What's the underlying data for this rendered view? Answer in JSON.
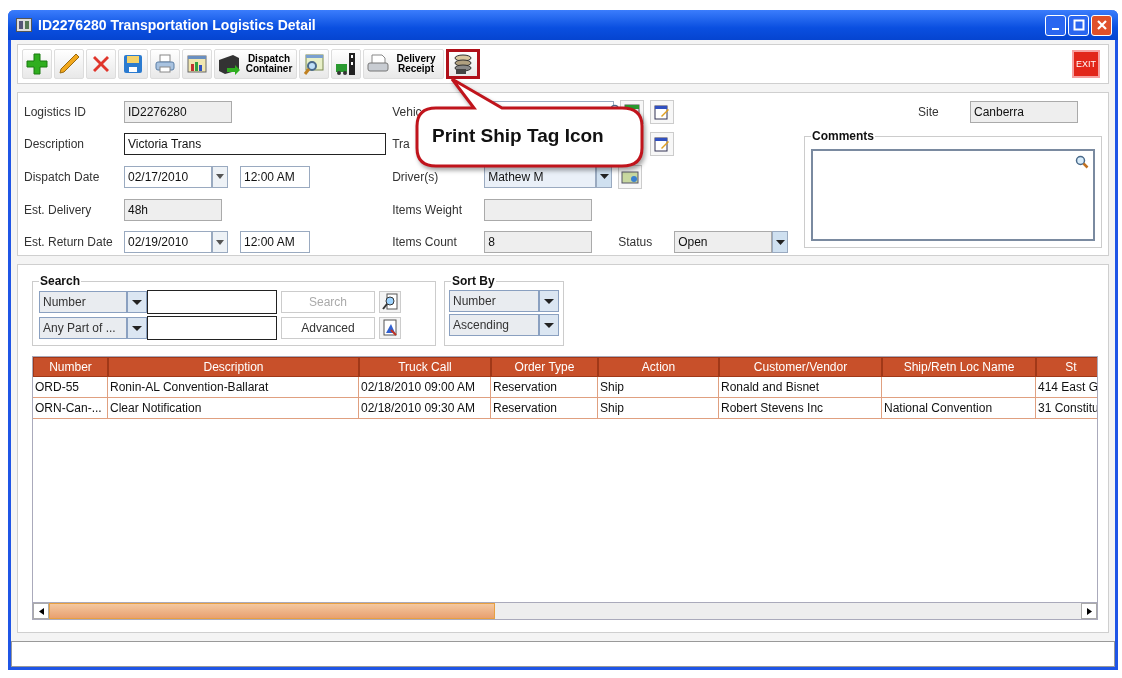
{
  "window": {
    "title": "ID2276280 Transportation Logistics Detail"
  },
  "toolbar": [
    {
      "kind": "icon",
      "highlighted": false
    },
    {
      "kind": "icon",
      "highlighted": false
    },
    {
      "kind": "icon",
      "highlighted": false
    },
    {
      "kind": "icon",
      "highlighted": false
    },
    {
      "kind": "icon",
      "highlighted": false
    },
    {
      "kind": "icon",
      "highlighted": false
    },
    {
      "kind": "labeled",
      "label": "Dispatch Container",
      "highlighted": false
    },
    {
      "kind": "icon",
      "highlighted": false
    },
    {
      "kind": "icon",
      "highlighted": false
    },
    {
      "kind": "labeled",
      "label": "Delivery Receipt",
      "highlighted": false
    },
    {
      "kind": "icon",
      "highlighted": true
    }
  ],
  "exit_button": {
    "label": "EXIT"
  },
  "callout": {
    "text": "Print Ship Tag Icon"
  },
  "form": {
    "logistics_id": {
      "label": "Logistics ID",
      "value": "ID2276280",
      "readonly": true
    },
    "description": {
      "label": "Description",
      "value": "Victoria Trans",
      "readonly": false
    },
    "dispatch_date": {
      "label": "Dispatch Date",
      "date": "02/17/2010",
      "time": "12:00 AM"
    },
    "est_delivery": {
      "label": "Est. Delivery",
      "value": "48h",
      "readonly": true
    },
    "est_return_date": {
      "label": "Est. Return Date",
      "date": "02/19/2010",
      "time": "12:00 AM"
    },
    "vehicle": {
      "label": "Vehic"
    },
    "transport": {
      "label": "Tra"
    },
    "drivers": {
      "label": "Driver(s)",
      "value": "Mathew M"
    },
    "items_weight": {
      "label": "Items Weight",
      "readonly": true
    },
    "items_count": {
      "label": "Items Count",
      "value": "8",
      "readonly": true
    },
    "status": {
      "label": "Status",
      "value": "Open"
    },
    "site": {
      "label": "Site",
      "value": "Canberra",
      "readonly": true
    },
    "comments": {
      "label": "Comments"
    }
  },
  "search": {
    "title": "Search",
    "field": "Number",
    "match": "Any Part of ...",
    "search_button": {
      "label": "Search",
      "disabled": true
    },
    "advanced_button": {
      "label": "Advanced",
      "disabled": false
    }
  },
  "sort_by": {
    "title": "Sort By",
    "field": "Number",
    "order": "Ascending"
  },
  "table": {
    "columns": [
      "Number",
      "Description",
      "Truck Call",
      "Order Type",
      "Action",
      "Customer/Vendor",
      "Ship/Retn Loc Name",
      "St"
    ],
    "rows": [
      [
        "ORD-55",
        "Ronin-AL Convention-Ballarat",
        "02/18/2010 09:00 AM",
        "Reservation",
        "Ship",
        "Ronald and  Bisnet",
        null,
        "414 East G"
      ],
      [
        "ORN-Can-...",
        "Clear Notification",
        "02/18/2010 09:30 AM",
        "Reservation",
        "Ship",
        "Robert Stevens Inc",
        "National Convention",
        "31 Constitu"
      ]
    ]
  }
}
